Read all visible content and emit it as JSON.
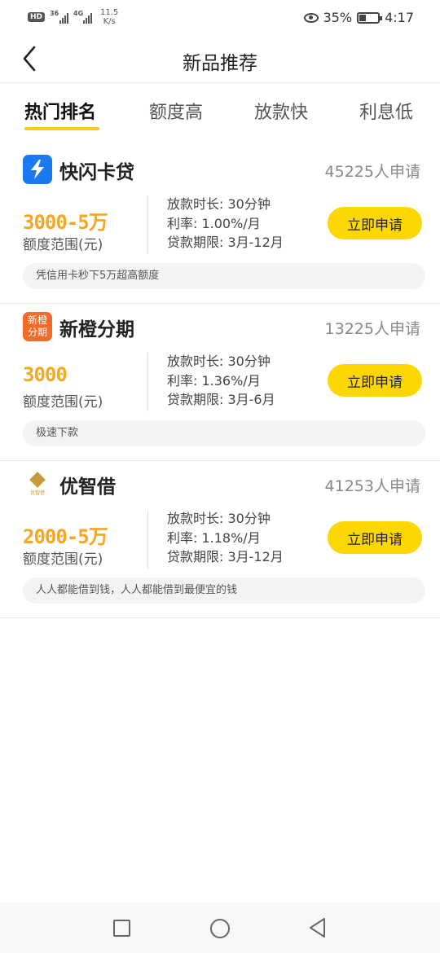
{
  "status_bar": {
    "hd": "HD",
    "net1": "36",
    "net2": "4G",
    "speed_value": "11.5",
    "speed_unit": "K/s",
    "battery_percent": "35%",
    "time": "4:17"
  },
  "nav": {
    "title": "新品推荐"
  },
  "tabs": [
    {
      "label": "热门排名",
      "active": true
    },
    {
      "label": "额度高",
      "active": false
    },
    {
      "label": "放款快",
      "active": false
    },
    {
      "label": "利息低",
      "active": false
    }
  ],
  "products": [
    {
      "name": "快闪卡贷",
      "applicants": "45225人申请",
      "amount": "3000-5万",
      "amount_label": "额度范围(元)",
      "loan_time": "放款时长: 30分钟",
      "rate": "利率: 1.00%/月",
      "term": "贷款期限: 3月-12月",
      "apply_label": "立即申请",
      "note": "凭信用卡秒下5万超高额度",
      "logo_icon": "lightning-icon",
      "logo_color": "#1b7af0"
    },
    {
      "name": "新橙分期",
      "applicants": "13225人申请",
      "amount": "3000",
      "amount_label": "额度范围(元)",
      "loan_time": "放款时长: 30分钟",
      "rate": "利率: 1.36%/月",
      "term": "贷款期限: 3月-6月",
      "apply_label": "立即申请",
      "note": "极速下款",
      "logo_text_top": "新橙",
      "logo_text_bottom": "分期",
      "logo_color": "#f36b2b"
    },
    {
      "name": "优智借",
      "applicants": "41253人申请",
      "amount": "2000-5万",
      "amount_label": "额度范围(元)",
      "loan_time": "放款时长: 30分钟",
      "rate": "利率: 1.18%/月",
      "term": "贷款期限: 3月-12月",
      "apply_label": "立即申请",
      "note": "人人都能借到钱，人人都能借到最便宜的钱",
      "logo_small_text": "优智借",
      "logo_color": "#c79a3b"
    }
  ],
  "colors": {
    "accent_yellow": "#fcd703",
    "amount_orange": "#f5a623",
    "tab_underline": "#f7c81d"
  }
}
